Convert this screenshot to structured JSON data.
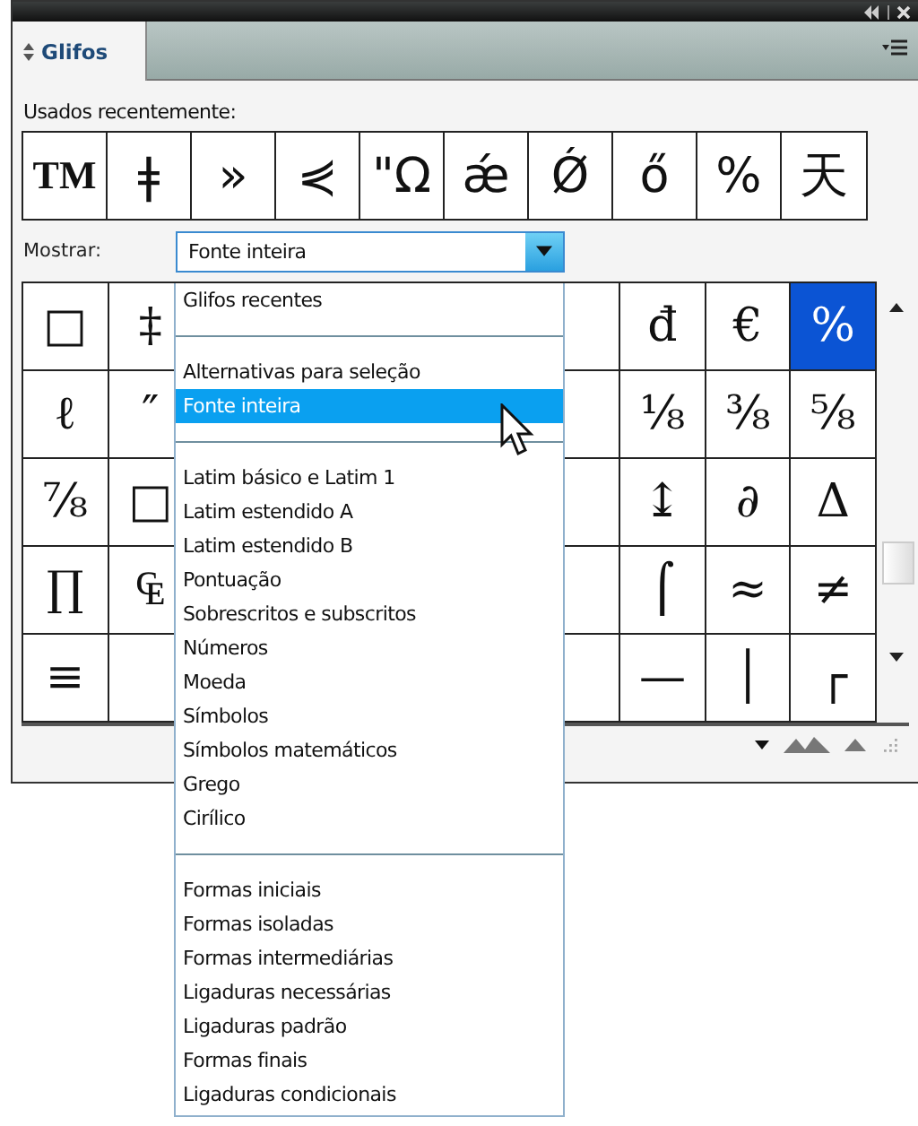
{
  "panel": {
    "title": "Glifos"
  },
  "recent": {
    "label": "Usados recentemente:",
    "glyphs": [
      "TM",
      "ǂ",
      "»",
      "⋞",
      "\"Ω",
      "ǽ",
      "Ǿ",
      "ő",
      "%",
      "天"
    ]
  },
  "show": {
    "label": "Mostrar:",
    "value": "Fonte inteira",
    "expanded": true
  },
  "grid": [
    {
      "left": [
        {
          "glyph": "□",
          "selected": false
        },
        {
          "glyph": "‡",
          "selected": false
        }
      ],
      "right": [
        {
          "glyph": "đ",
          "selected": false
        },
        {
          "glyph": "€",
          "selected": false
        },
        {
          "glyph": "%",
          "selected": true
        }
      ]
    },
    {
      "left": [
        {
          "glyph": "ℓ",
          "selected": false
        },
        {
          "glyph": "″",
          "selected": false
        }
      ],
      "right": [
        {
          "glyph": "⅛",
          "selected": false
        },
        {
          "glyph": "⅜",
          "selected": false
        },
        {
          "glyph": "⅝",
          "selected": false
        }
      ]
    },
    {
      "left": [
        {
          "glyph": "⅞",
          "selected": false
        },
        {
          "glyph": "□",
          "selected": false
        }
      ],
      "right": [
        {
          "glyph": "↨",
          "selected": false
        },
        {
          "glyph": "∂",
          "selected": false
        },
        {
          "glyph": "Δ",
          "selected": false
        }
      ]
    },
    {
      "left": [
        {
          "glyph": "∏",
          "selected": false
        },
        {
          "glyph": "₠",
          "selected": false
        }
      ],
      "right": [
        {
          "glyph": "⌠",
          "selected": false
        },
        {
          "glyph": "≈",
          "selected": false
        },
        {
          "glyph": "≠",
          "selected": false
        }
      ]
    },
    {
      "left": [
        {
          "glyph": "≡",
          "selected": false
        }
      ],
      "right": [
        {
          "glyph": "—",
          "selected": false
        },
        {
          "glyph": "│",
          "selected": false
        },
        {
          "glyph": "┌",
          "selected": false
        }
      ]
    }
  ],
  "menu": [
    [
      {
        "label": "Glifos recentes",
        "selected": false
      }
    ],
    [
      {
        "label": "Alternativas para seleção",
        "selected": false
      },
      {
        "label": "Fonte inteira",
        "selected": true
      }
    ],
    [
      {
        "label": "Latim básico e Latim 1",
        "selected": false
      },
      {
        "label": "Latim estendido A",
        "selected": false
      },
      {
        "label": "Latim estendido B",
        "selected": false
      },
      {
        "label": "Pontuação",
        "selected": false
      },
      {
        "label": "Sobrescritos e subscritos",
        "selected": false
      },
      {
        "label": "Números",
        "selected": false
      },
      {
        "label": "Moeda",
        "selected": false
      },
      {
        "label": "Símbolos",
        "selected": false
      },
      {
        "label": "Símbolos matemáticos",
        "selected": false
      },
      {
        "label": "Grego",
        "selected": false
      },
      {
        "label": "Cirílico",
        "selected": false
      }
    ],
    [
      {
        "label": "Formas iniciais",
        "selected": false
      },
      {
        "label": "Formas isoladas",
        "selected": false
      },
      {
        "label": "Formas intermediárias",
        "selected": false
      },
      {
        "label": "Ligaduras necessárias",
        "selected": false
      },
      {
        "label": "Ligaduras padrão",
        "selected": false
      },
      {
        "label": "Formas finais",
        "selected": false
      },
      {
        "label": "Ligaduras condicionais",
        "selected": false
      }
    ]
  ]
}
